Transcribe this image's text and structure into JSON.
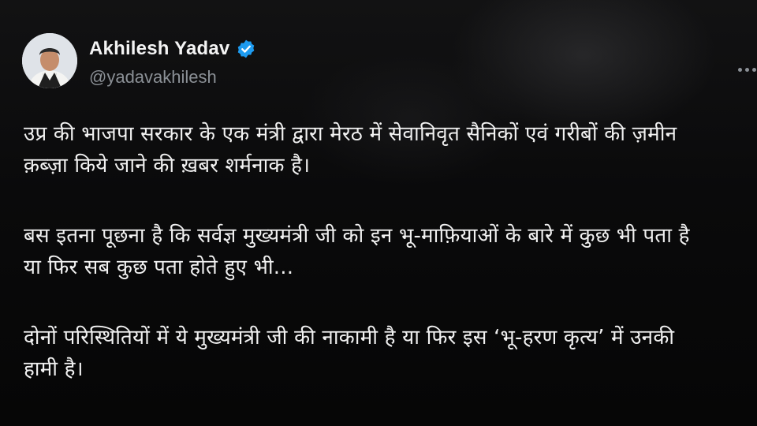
{
  "author": {
    "display_name": "Akhilesh Yadav",
    "handle": "@yadavakhilesh",
    "verified": true,
    "avatar_icon": "profile-photo"
  },
  "colors": {
    "background": "#0a0a0b",
    "text": "#f1f1f1",
    "handle": "#8b9096",
    "verified": "#1d9bf0"
  },
  "tweet": {
    "paragraphs": [
      "उप्र की भाजपा सरकार के एक मंत्री द्वारा मेरठ में सेवानिवृत सैनिकों एवं गरीबों की ज़मीन\nक़ब्ज़ा किये जाने की ख़बर शर्मनाक है।",
      "बस इतना पूछना है कि सर्वज्ञ मुख्यमंत्री जी  को इन भू-माफ़ियाओं के बारे में कुछ भी पता है\nया फिर सब कुछ पता होते हुए भी...",
      "दोनों परिस्थितियों में ये मुख्यमंत्री जी की नाकामी है या फिर इस ‘भू-हरण कृत्य’ में उनकी\nहामी है।"
    ]
  },
  "icons": [
    "verified-badge-icon",
    "more-options-icon"
  ]
}
